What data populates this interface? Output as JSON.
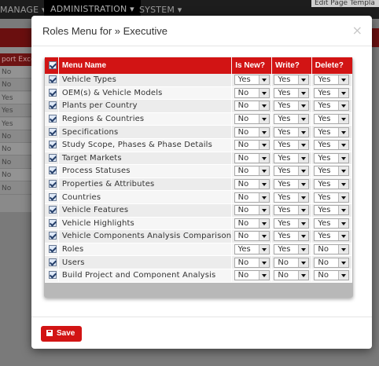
{
  "background": {
    "nav": [
      "MANAGE ▾",
      "ADMINISTRATION ▾",
      "SYSTEM ▾"
    ],
    "edit_link": "Edit Page Templa",
    "panel_header": "port Exce",
    "panel_cells": [
      "No",
      "No",
      "Yes",
      "Yes",
      "Yes",
      "No",
      "No",
      "No",
      "No",
      "No"
    ]
  },
  "modal": {
    "title": "Roles Menu for » Executive",
    "close_symbol": "×",
    "headers": {
      "menu_name": "Menu Name",
      "is_new": "Is New?",
      "write": "Write?",
      "delete": "Delete?"
    },
    "rows": [
      {
        "name": "Vehicle Types",
        "checked": true,
        "is_new": "Yes",
        "write": "Yes",
        "delete": "Yes"
      },
      {
        "name": "OEM(s) & Vehicle Models",
        "checked": true,
        "is_new": "No",
        "write": "Yes",
        "delete": "Yes"
      },
      {
        "name": "Plants per Country",
        "checked": true,
        "is_new": "No",
        "write": "Yes",
        "delete": "Yes"
      },
      {
        "name": "Regions & Countries",
        "checked": true,
        "is_new": "No",
        "write": "Yes",
        "delete": "Yes"
      },
      {
        "name": "Specifications",
        "checked": true,
        "is_new": "No",
        "write": "Yes",
        "delete": "Yes"
      },
      {
        "name": "Study Scope, Phases & Phase Details",
        "checked": true,
        "is_new": "No",
        "write": "Yes",
        "delete": "Yes"
      },
      {
        "name": "Target Markets",
        "checked": true,
        "is_new": "No",
        "write": "Yes",
        "delete": "Yes"
      },
      {
        "name": "Process Statuses",
        "checked": true,
        "is_new": "No",
        "write": "Yes",
        "delete": "Yes"
      },
      {
        "name": "Properties & Attributes",
        "checked": true,
        "is_new": "No",
        "write": "Yes",
        "delete": "Yes"
      },
      {
        "name": "Countries",
        "checked": true,
        "is_new": "No",
        "write": "Yes",
        "delete": "Yes"
      },
      {
        "name": "Vehicle Features",
        "checked": true,
        "is_new": "No",
        "write": "Yes",
        "delete": "Yes"
      },
      {
        "name": "Vehicle Highlights",
        "checked": true,
        "is_new": "No",
        "write": "Yes",
        "delete": "Yes"
      },
      {
        "name": "Vehicle Components Analysis Comparison",
        "checked": true,
        "is_new": "No",
        "write": "Yes",
        "delete": "Yes"
      },
      {
        "name": "Roles",
        "checked": true,
        "is_new": "Yes",
        "write": "Yes",
        "delete": "No"
      },
      {
        "name": "Users",
        "checked": true,
        "is_new": "No",
        "write": "No",
        "delete": "No"
      },
      {
        "name": "Build Project and Component Analysis",
        "checked": true,
        "is_new": "No",
        "write": "No",
        "delete": "No"
      }
    ],
    "save_label": "Save"
  },
  "colors": {
    "accent": "#d21414",
    "nav_bg": "#1d1d1d",
    "overlay_red": "#6a0f0f"
  }
}
